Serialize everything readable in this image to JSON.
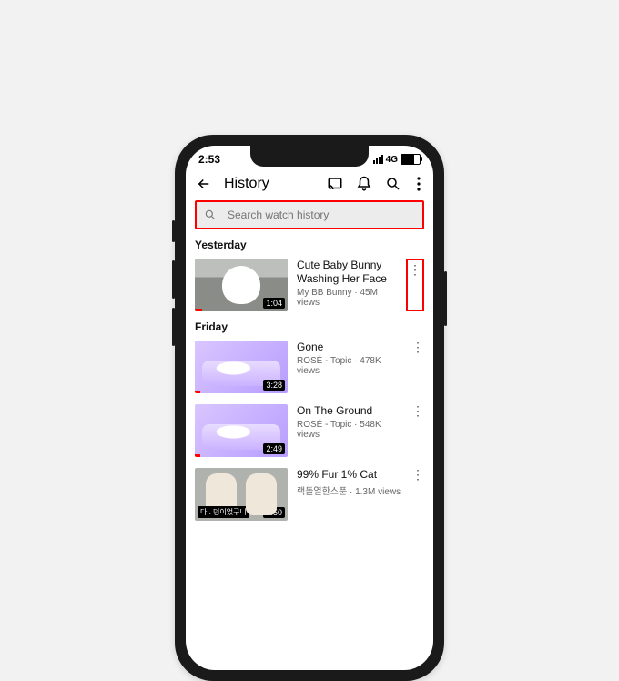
{
  "status": {
    "time": "2:53",
    "net": "4G"
  },
  "header": {
    "title": "History"
  },
  "search": {
    "placeholder": "Search watch history"
  },
  "sections": [
    {
      "label": "Yesterday",
      "items": [
        {
          "title": "Cute Baby Bunny Washing Her Face",
          "channel": "My BB Bunny",
          "views": "45M views",
          "duration": "1:04",
          "progress": 8,
          "highlight_more": true,
          "thumb": "t1"
        }
      ]
    },
    {
      "label": "Friday",
      "items": [
        {
          "title": "Gone",
          "channel": "ROSÉ - Topic",
          "views": "478K views",
          "duration": "3:28",
          "progress": 6,
          "highlight_more": false,
          "thumb": "t2"
        },
        {
          "title": "On The Ground",
          "channel": "ROSÉ - Topic",
          "views": "548K views",
          "duration": "2:49",
          "progress": 6,
          "highlight_more": false,
          "thumb": "t3"
        },
        {
          "title": "99% Fur 1% Cat",
          "channel": "랙돌열한스푼",
          "views": "1.3M views",
          "duration": "9:50",
          "progress": 0,
          "highlight_more": false,
          "thumb": "t4",
          "caption": "다..  덩이었구니"
        }
      ]
    }
  ]
}
